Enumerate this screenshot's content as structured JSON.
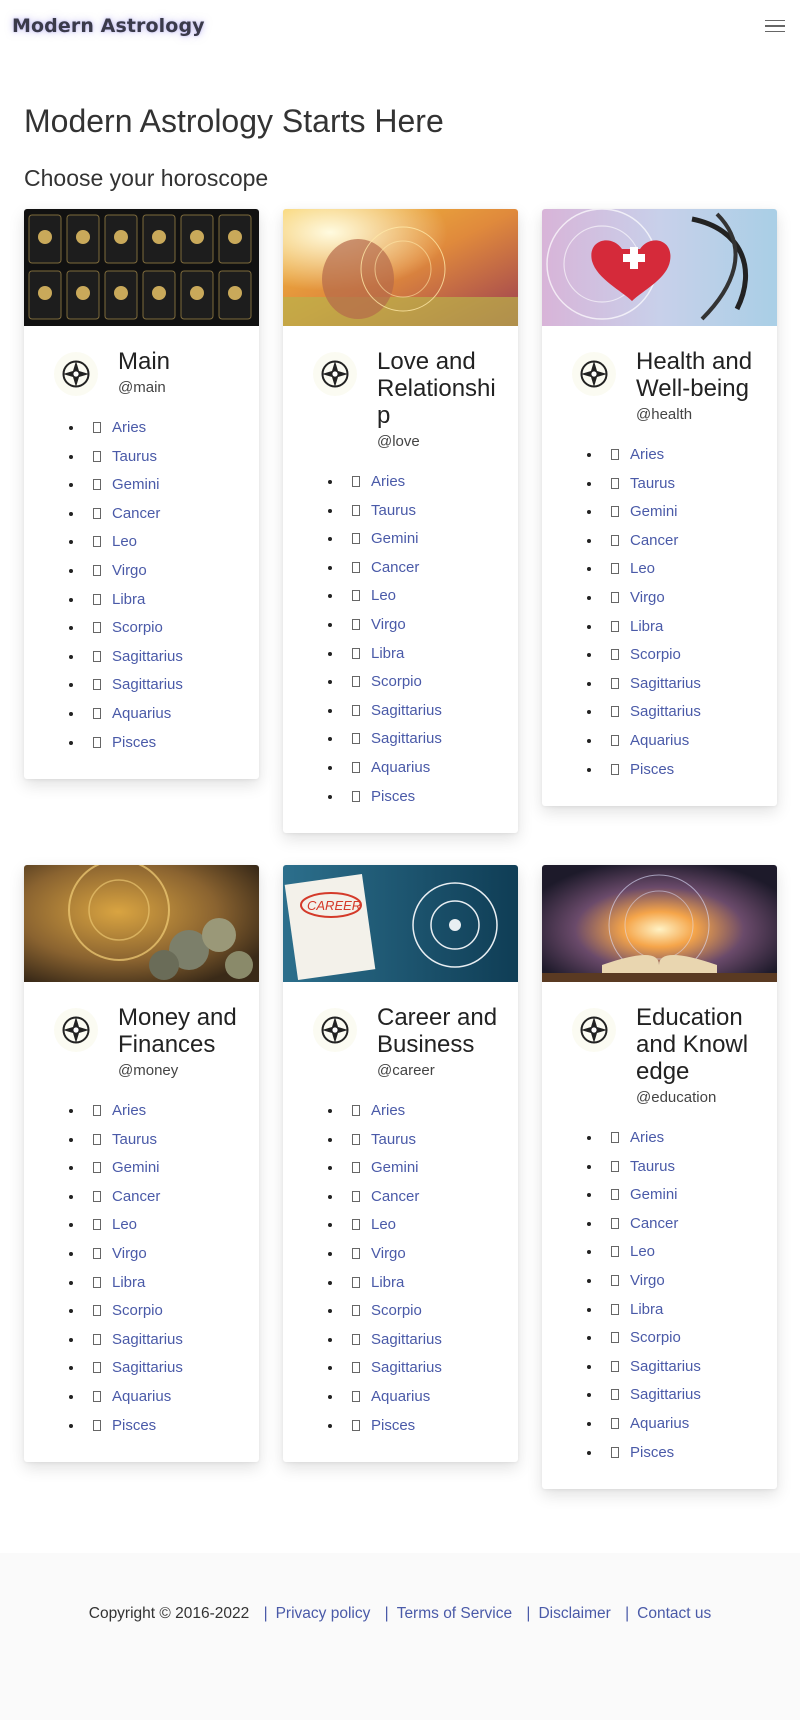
{
  "brand": "Modern Astrology",
  "page_title": "Modern Astrology Starts Here",
  "subtitle": "Choose your horoscope",
  "signs": [
    "Aries",
    "Taurus",
    "Gemini",
    "Cancer",
    "Leo",
    "Virgo",
    "Libra",
    "Scorpio",
    "Sagittarius",
    "Sagittarius",
    "Aquarius",
    "Pisces"
  ],
  "cards": [
    {
      "title": "Main",
      "handle": "@main"
    },
    {
      "title": "Love and Relationship",
      "handle": "@love"
    },
    {
      "title": "Health and Well-being",
      "handle": "@health"
    },
    {
      "title": "Money and Finances",
      "handle": "@money"
    },
    {
      "title": "Career and Business",
      "handle": "@career"
    },
    {
      "title": "Education and Knowledge",
      "handle": "@education"
    }
  ],
  "footer": {
    "copyright": "Copyright © 2016-2022",
    "links": [
      "Privacy policy",
      "Terms of Service",
      "Disclaimer",
      "Contact us"
    ],
    "separator": "|"
  },
  "colors": {
    "link": "#4a5aa8",
    "footer_bg": "#fafafa"
  },
  "icons": {
    "card_avatar": "compass-icon",
    "menu": "hamburger-menu-icon"
  }
}
